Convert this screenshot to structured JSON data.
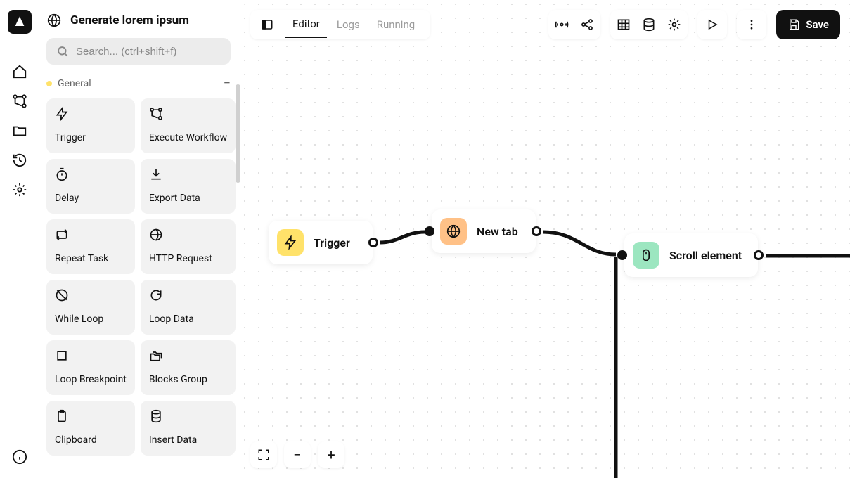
{
  "page_title": "Generate lorem ipsum",
  "search_placeholder": "Search... (ctrl+shift+f)",
  "section": {
    "label": "General"
  },
  "palette_items": [
    {
      "label": "Trigger",
      "icon": "bolt"
    },
    {
      "label": "Execute Workflow",
      "icon": "workflow"
    },
    {
      "label": "Delay",
      "icon": "timer"
    },
    {
      "label": "Export Data",
      "icon": "download"
    },
    {
      "label": "Repeat Task",
      "icon": "repeat"
    },
    {
      "label": "HTTP Request",
      "icon": "globe-slash"
    },
    {
      "label": "While Loop",
      "icon": "while"
    },
    {
      "label": "Loop Data",
      "icon": "loop"
    },
    {
      "label": "Loop Breakpoint",
      "icon": "square"
    },
    {
      "label": "Blocks Group",
      "icon": "folders"
    },
    {
      "label": "Clipboard",
      "icon": "clipboard"
    },
    {
      "label": "Insert Data",
      "icon": "database"
    }
  ],
  "tabs": {
    "editor": "Editor",
    "logs": "Logs",
    "running": "Running"
  },
  "save_label": "Save",
  "nodes": {
    "trigger": {
      "label": "Trigger",
      "color": "#ffe26a"
    },
    "newtab": {
      "label": "New tab",
      "color": "#ffc187"
    },
    "scroll": {
      "label": "Scroll element",
      "color": "#9ce6c0"
    }
  },
  "zoom": {
    "fit": "fit",
    "out": "−",
    "in": "+"
  }
}
